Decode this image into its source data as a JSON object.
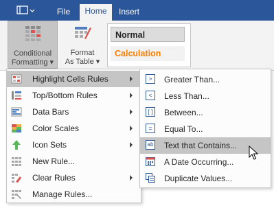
{
  "tabs": {
    "file": "File",
    "home": "Home",
    "insert": "Insert"
  },
  "ribbon": {
    "conditional_formatting": {
      "line1": "Conditional",
      "line2": "Formatting ▾"
    },
    "format_as_table": {
      "line1": "Format",
      "line2": "As Table ▾"
    },
    "styles": {
      "normal": "Normal",
      "calculation": "Calculation"
    }
  },
  "menu": {
    "items": [
      {
        "label": "Highlight Cells Rules",
        "icon": "highlight-cells-icon",
        "submenu": true
      },
      {
        "label": "Top/Bottom Rules",
        "icon": "top-bottom-icon",
        "submenu": true
      },
      {
        "label": "Data Bars",
        "icon": "data-bars-icon",
        "submenu": true
      },
      {
        "label": "Color Scales",
        "icon": "color-scales-icon",
        "submenu": true
      },
      {
        "label": "Icon Sets",
        "icon": "icon-sets-icon",
        "submenu": true
      },
      {
        "label": "New Rule...",
        "icon": "new-rule-icon",
        "submenu": false
      },
      {
        "label": "Clear Rules",
        "icon": "clear-rules-icon",
        "submenu": true
      },
      {
        "label": "Manage Rules...",
        "icon": "manage-rules-icon",
        "submenu": false
      }
    ]
  },
  "submenu": {
    "items": [
      {
        "label": "Greater Than...",
        "icon": "greater-than-icon",
        "glyph": ">"
      },
      {
        "label": "Less Than...",
        "icon": "less-than-icon",
        "glyph": "<"
      },
      {
        "label": "Between...",
        "icon": "between-icon",
        "glyph": "[ ]"
      },
      {
        "label": "Equal To...",
        "icon": "equal-to-icon",
        "glyph": "="
      },
      {
        "label": "Text that Contains...",
        "icon": "text-contains-icon",
        "glyph": "ab"
      },
      {
        "label": "A Date Occurring...",
        "icon": "date-occurring-icon",
        "glyph": ""
      },
      {
        "label": "Duplicate Values...",
        "icon": "duplicate-values-icon",
        "glyph": ""
      }
    ]
  },
  "colors": {
    "accent": "#2b579a",
    "calculation_text": "#fa7d00",
    "highlight": "#c5c5c5"
  }
}
